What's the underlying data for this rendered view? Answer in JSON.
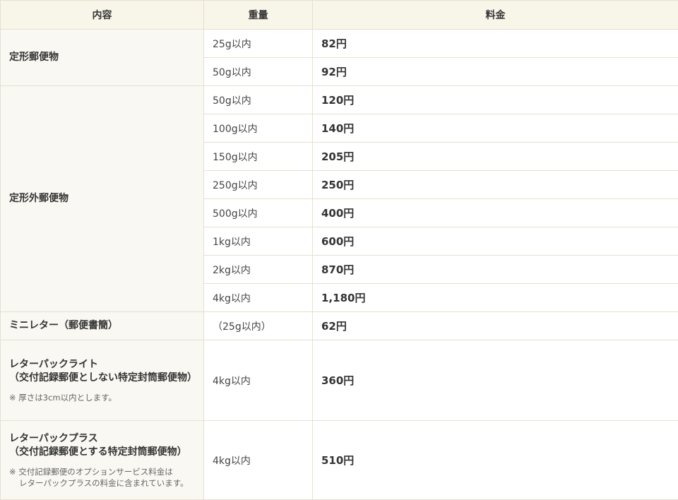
{
  "headers": {
    "content": "内容",
    "weight": "重量",
    "price": "料金"
  },
  "groups": {
    "teikei": {
      "name": "定形郵便物",
      "rows": [
        {
          "weight": "25g以内",
          "price": "82円"
        },
        {
          "weight": "50g以内",
          "price": "92円"
        }
      ]
    },
    "teikeigai": {
      "name": "定形外郵便物",
      "rows": [
        {
          "weight": "50g以内",
          "price": "120円"
        },
        {
          "weight": "100g以内",
          "price": "140円"
        },
        {
          "weight": "150g以内",
          "price": "205円"
        },
        {
          "weight": "250g以内",
          "price": "250円"
        },
        {
          "weight": "500g以内",
          "price": "400円"
        },
        {
          "weight": "1kg以内",
          "price": "600円"
        },
        {
          "weight": "2kg以内",
          "price": "870円"
        },
        {
          "weight": "4kg以内",
          "price": "1,180円"
        }
      ]
    },
    "mini_letter": {
      "name": "ミニレター（郵便書簡）",
      "weight": "（25g以内）",
      "price": "62円"
    },
    "letterpack_light": {
      "title_line1": "レターパックライト",
      "title_line2": "（交付記録郵便としない特定封筒郵便物）",
      "note": "※ 厚さは3cm以内とします。",
      "weight": "4kg以内",
      "price": "360円"
    },
    "letterpack_plus": {
      "title_line1": "レターパックプラス",
      "title_line2": "（交付記録郵便とする特定封筒郵便物）",
      "note_line1": "※ 交付記録郵便のオプションサービス料金は",
      "note_line2": "レターパックプラスの料金に含まれています。",
      "weight": "4kg以内",
      "price": "510円"
    }
  }
}
